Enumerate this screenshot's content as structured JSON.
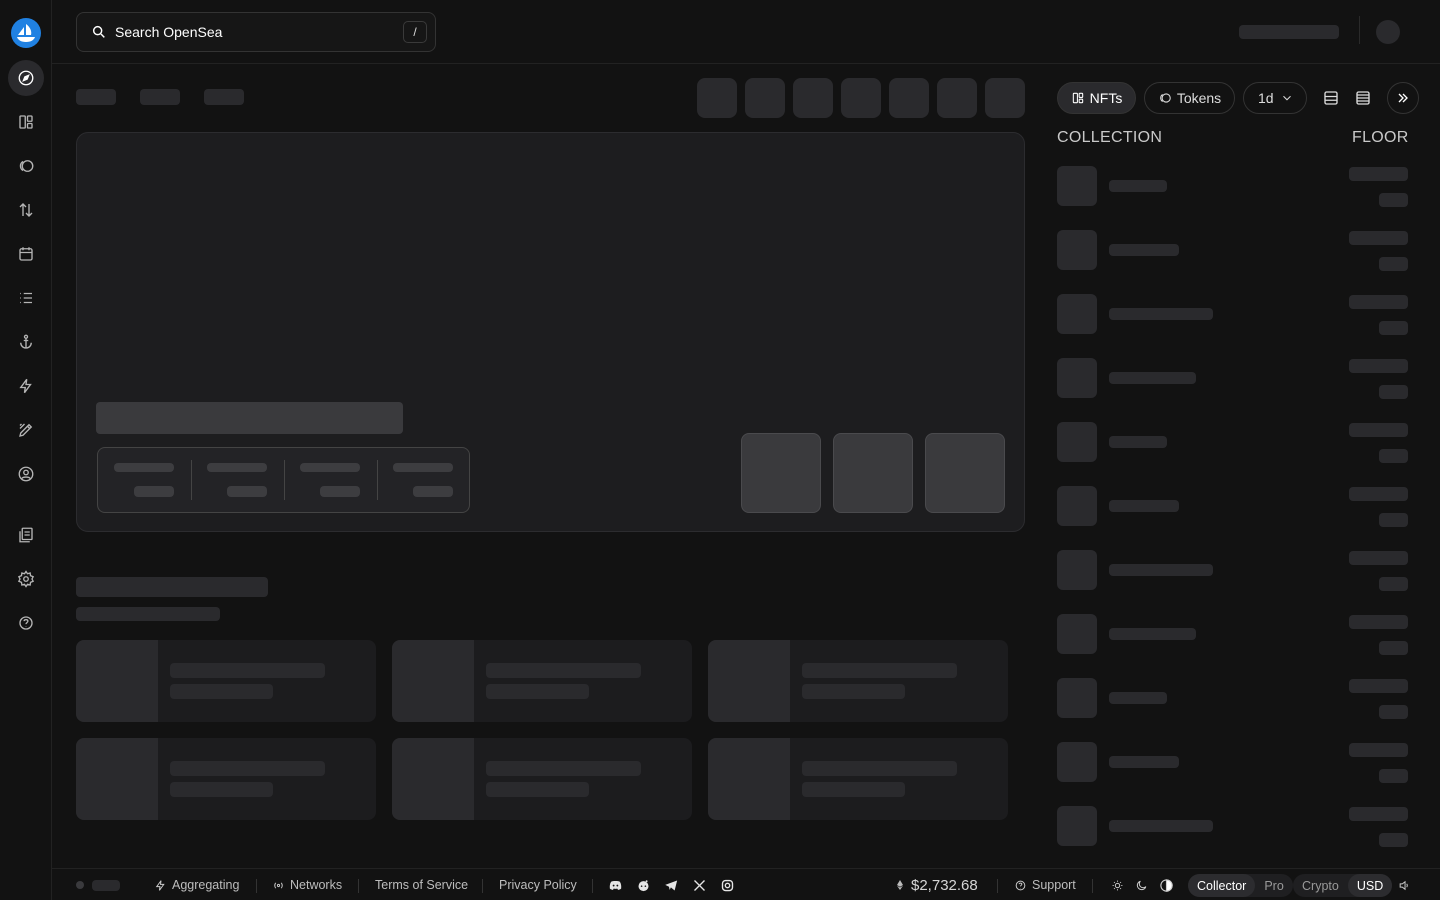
{
  "search": {
    "placeholder": "Search OpenSea",
    "shortcut": "/"
  },
  "sidebar": {
    "items": [
      {
        "name": "discover",
        "icon": "compass-icon"
      },
      {
        "name": "collections",
        "icon": "grid-icon"
      },
      {
        "name": "tokens",
        "icon": "tokens-icon"
      },
      {
        "name": "swap",
        "icon": "swap-icon"
      },
      {
        "name": "drops",
        "icon": "calendar-icon"
      },
      {
        "name": "activity",
        "icon": "list-icon"
      },
      {
        "name": "rewards",
        "icon": "anchor-icon"
      },
      {
        "name": "studio",
        "icon": "bolt-icon"
      },
      {
        "name": "create",
        "icon": "pen-icon"
      },
      {
        "name": "profile",
        "icon": "user-circle-icon"
      },
      {
        "name": "resources",
        "icon": "book-icon"
      },
      {
        "name": "settings",
        "icon": "gear-icon"
      },
      {
        "name": "support",
        "icon": "help-icon"
      }
    ]
  },
  "right_panel": {
    "tabs": [
      {
        "label": "NFTs",
        "icon": "grid-icon",
        "active": true
      },
      {
        "label": "Tokens",
        "icon": "tokens-icon",
        "active": false
      }
    ],
    "timeframe": "1d",
    "columns": {
      "collection": "COLLECTION",
      "floor": "FLOOR"
    }
  },
  "footer": {
    "aggregating": "Aggregating",
    "networks": "Networks",
    "terms": "Terms of Service",
    "privacy": "Privacy Policy",
    "eth_price": "$2,732.68",
    "support": "Support",
    "mode_options": [
      "Collector",
      "Pro"
    ],
    "mode_selected": "Collector",
    "currency_options": [
      "Crypto",
      "USD"
    ],
    "currency_selected": "USD",
    "social": [
      "discord-icon",
      "reddit-icon",
      "telegram-icon",
      "x-icon",
      "instagram-icon"
    ]
  },
  "colors": {
    "background": "#121212",
    "skeleton": "#2a2a2d",
    "brand": "#2081e2"
  }
}
